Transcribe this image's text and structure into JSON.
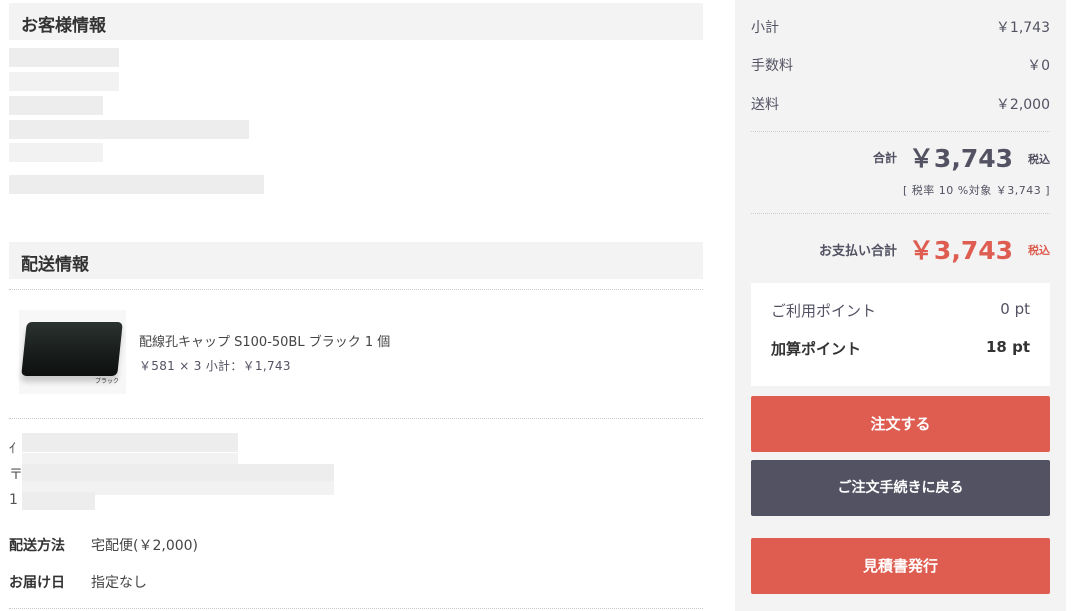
{
  "customer": {
    "heading": "お客様情報"
  },
  "shipping": {
    "heading": "配送情報",
    "product": {
      "name": "配線孔キャップ S100-50BL ブラック 1 個",
      "price_line": "￥581 × 3  小計：￥1,743",
      "image_label": "ブラック"
    },
    "partial_text": [
      "ｲ",
      "〒",
      "1"
    ],
    "method_label": "配送方法",
    "method_value": "宅配便(￥2,000)",
    "delivery_label": "お届け日",
    "delivery_value": "指定なし"
  },
  "summary": {
    "subtotal_label": "小計",
    "subtotal_value": "￥1,743",
    "fee_label": "手数料",
    "fee_value": "￥0",
    "shipping_label": "送料",
    "shipping_value": "￥2,000",
    "total_label": "合計",
    "total_value": "￥3,743",
    "tax_inc": "税込",
    "tax_note": "[ 税率 10 %対象 ￥3,743 ]",
    "payment_label": "お支払い合計",
    "payment_value": "￥3,743"
  },
  "points": {
    "used_label": "ご利用ポイント",
    "used_value": "0 pt",
    "earned_label": "加算ポイント",
    "earned_value": "18 pt"
  },
  "buttons": {
    "order": "注文する",
    "back": "ご注文手続きに戻る",
    "quote": "見積書発行"
  },
  "colors": {
    "accent": "#de5d50",
    "dark_button": "#525263",
    "panel_bg": "#f3f3f3"
  }
}
